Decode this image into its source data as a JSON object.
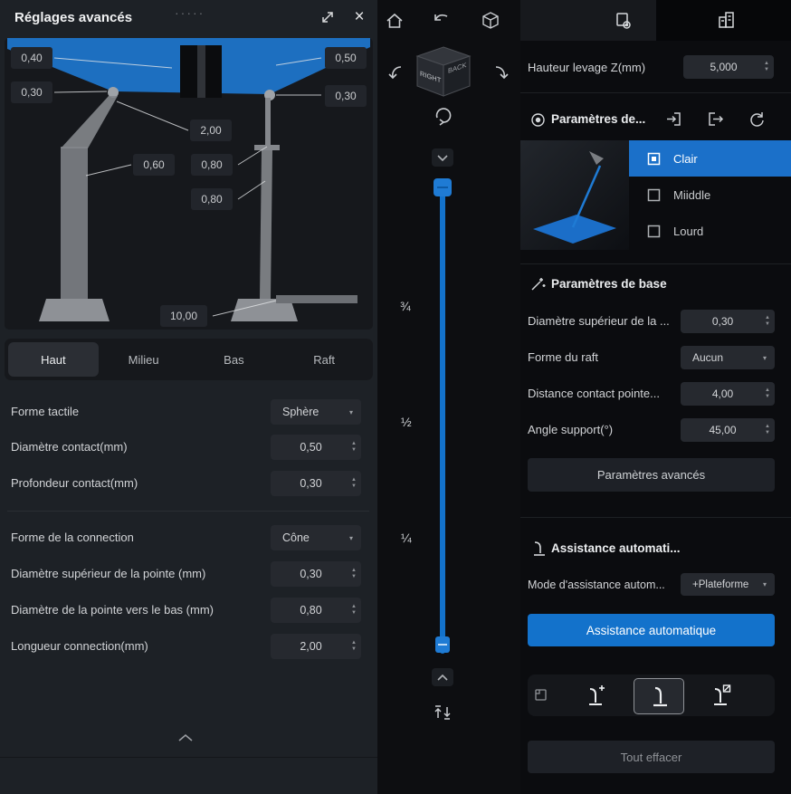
{
  "colors": {
    "accent": "#1372cb"
  },
  "glyphs": {
    "dropdown_arrow": "▾",
    "spin_up": "▲",
    "spin_down": "▼",
    "close": "×",
    "drag_dots": "·····"
  },
  "left_panel": {
    "title": "Réglages avancés",
    "diagram_labels": {
      "top_left": "0,40",
      "top_right": "0,50",
      "mid_left": "0,30",
      "mid_right": "0,30",
      "connection_length": "2,00",
      "tip_top": "0,60",
      "tip_upper": "0,80",
      "tip_lower": "0,80",
      "base_width": "10,00"
    },
    "tabs": [
      {
        "label": "Haut"
      },
      {
        "label": "Milieu"
      },
      {
        "label": "Bas"
      },
      {
        "label": "Raft"
      }
    ],
    "fields": [
      {
        "label": "Forme tactile",
        "value": "Sphère"
      },
      {
        "label": "Diamètre contact(mm)",
        "value": "0,50"
      },
      {
        "label": "Profondeur contact(mm)",
        "value": "0,30"
      },
      {
        "label": "Forme de la connection",
        "value": "Cône"
      },
      {
        "label": "Diamètre supérieur de la pointe (mm)",
        "value": "0,30"
      },
      {
        "label": "Diamètre de la pointe vers le bas (mm)",
        "value": "0,80"
      },
      {
        "label": "Longueur connection(mm)",
        "value": "2,00"
      }
    ]
  },
  "viewport": {
    "cube_left_face": "RIGHT",
    "cube_right_face": "BACK",
    "slider_marks": {
      "three_quarters": "¾",
      "half": "½",
      "quarter": "¼"
    }
  },
  "right_panel": {
    "lift_height_label": "Hauteur levage Z(mm)",
    "lift_height_value": "5,000",
    "profiles_title": "Paramètres de...",
    "profiles": [
      {
        "label": "Clair"
      },
      {
        "label": "Miiddle"
      },
      {
        "label": "Lourd"
      }
    ],
    "base_title": "Paramètres de base",
    "base_fields": [
      {
        "label": "Diamètre supérieur de la ...",
        "value": "0,30"
      },
      {
        "label": "Forme du raft",
        "value": "Aucun"
      },
      {
        "label": "Distance contact pointe...",
        "value": "4,00"
      },
      {
        "label": "Angle support(°)",
        "value": "45,00"
      }
    ],
    "advanced_button": "Paramètres avancés",
    "auto_title": "Assistance automati...",
    "auto_mode_label": "Mode d'assistance autom...",
    "auto_mode_value": "+Plateforme",
    "auto_button": "Assistance automatique",
    "clear_button": "Tout effacer"
  }
}
